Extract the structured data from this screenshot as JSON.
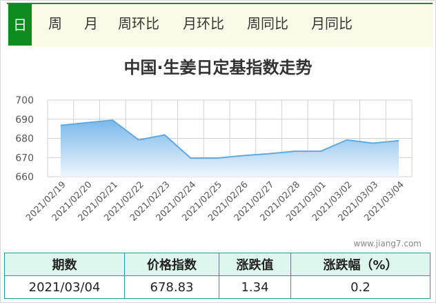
{
  "tabs": [
    "日",
    "周",
    "月",
    "周环比",
    "月环比",
    "周同比",
    "月同比"
  ],
  "active_tab": 0,
  "watermark": "www.jiang7.com",
  "chart_data": {
    "type": "area",
    "title": "中国·生姜日定基指数走势",
    "categories": [
      "2021/02/19",
      "2021/02/20",
      "2021/02/21",
      "2021/02/22",
      "2021/02/23",
      "2021/02/24",
      "2021/02/25",
      "2021/02/26",
      "2021/02/27",
      "2021/02/28",
      "2021/03/01",
      "2021/03/02",
      "2021/03/03",
      "2021/03/04"
    ],
    "values": [
      686.8,
      688.2,
      689.5,
      679.2,
      681.8,
      669.7,
      669.7,
      671.0,
      672.0,
      673.3,
      673.3,
      679.2,
      677.5,
      678.83
    ],
    "ylim": [
      660,
      700
    ],
    "yticks": [
      660,
      670,
      680,
      690,
      700
    ],
    "grid": true,
    "colors": {
      "line": "#5fa8e0",
      "fill_top": "#7bb8ea",
      "fill_bottom": "#eef6fd",
      "grid": "#d0d0d0"
    }
  },
  "table": {
    "headers": [
      "期数",
      "价格指数",
      "涨跌值",
      "涨跌幅（%）"
    ],
    "row": [
      "2021/03/04",
      "678.83",
      "1.34",
      "0.2"
    ]
  }
}
